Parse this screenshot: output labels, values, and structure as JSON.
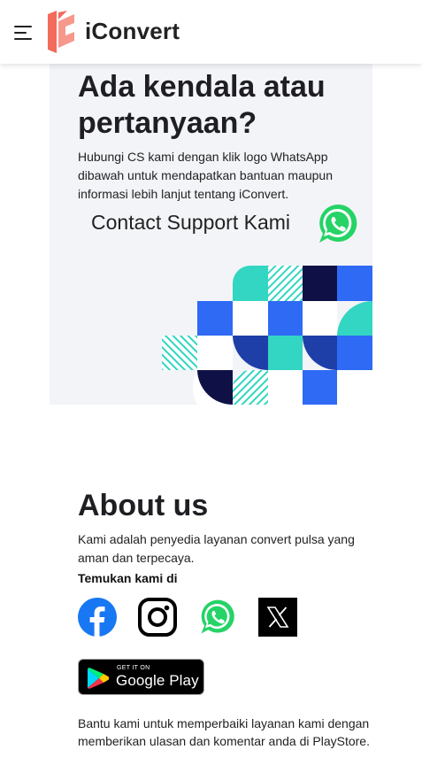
{
  "header": {
    "brand": "iConvert",
    "menu_icon": "hamburger-menu-icon",
    "logo_icon": "iconvert-logo-icon",
    "brand_color": "#f26b5b"
  },
  "support": {
    "title": "Ada kendala atau pertanyaan?",
    "description": "Hubungi CS kami dengan klik logo WhatsApp dibawah untuk mendapatkan bantuan maupun informasi lebih lanjut tentang iConvert.",
    "contact_label": "Contact Support Kami",
    "whatsapp_icon": "whatsapp-icon",
    "whatsapp_color": "#25d366",
    "pattern_colors": [
      "#2f6af5",
      "#33d6c2",
      "#0f1146",
      "#1e3fa8"
    ]
  },
  "about": {
    "title": "About us",
    "description": "Kami adalah penyedia layanan convert pulsa yang aman dan terpecaya.",
    "find_label": "Temukan kami di",
    "socials": [
      {
        "name": "facebook-icon",
        "color": "#1877f2"
      },
      {
        "name": "instagram-icon",
        "color": "#000000"
      },
      {
        "name": "whatsapp-icon",
        "color": "#25d366"
      },
      {
        "name": "x-icon",
        "color": "#000000"
      }
    ],
    "playstore": {
      "small_text": "GET IT ON",
      "big_text": "Google Play"
    },
    "feedback": "Bantu kami untuk memperbaiki layanan kami dengan memberikan ulasan dan komentar anda di PlayStore."
  }
}
